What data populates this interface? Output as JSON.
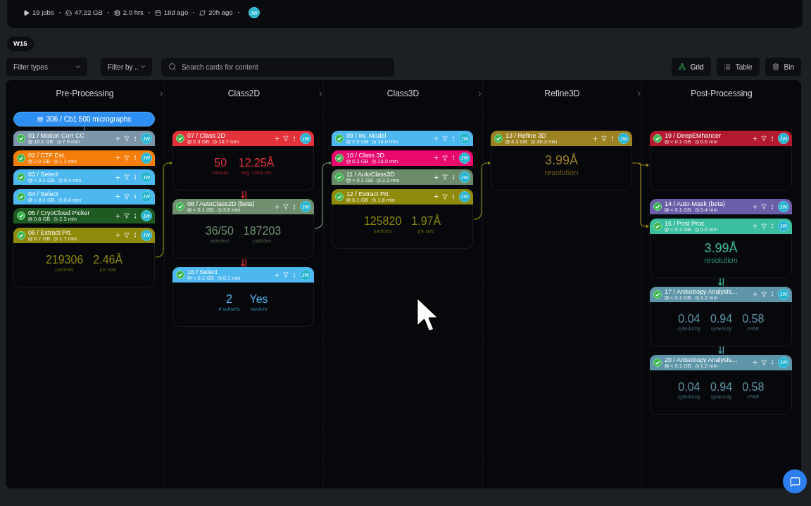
{
  "summary": {
    "stats": [
      {
        "kind": "jobs",
        "text": "19 jobs"
      },
      {
        "kind": "storage",
        "text": "47.22 GB"
      },
      {
        "kind": "compute",
        "text": "2.0 hrs"
      },
      {
        "kind": "created",
        "text": "18d ago"
      },
      {
        "kind": "updated",
        "text": "20h ago"
      }
    ],
    "owner": "JW"
  },
  "workspace_tag": "W15",
  "toolbar": {
    "filters": [
      {
        "label": "Filter types"
      },
      {
        "label": "Filter by .."
      }
    ],
    "search": {
      "placeholder": "Search cards for content"
    },
    "actions": [
      {
        "kind": "grid",
        "label": "Grid",
        "selected": true
      },
      {
        "kind": "table",
        "label": "Table",
        "selected": false
      },
      {
        "kind": "bin",
        "label": "Bin",
        "selected": false
      }
    ]
  },
  "board": {
    "columns": [
      {
        "title": "Pre-Processing",
        "source": "306 / Cb1 500 micrographs",
        "groups": [
          {
            "cards": [
              {
                "title": "01 / Motion Corr CC",
                "size": "16.1 GB",
                "time": "7.9 min",
                "color": "#7d95a8",
                "owner": "JW"
              },
              {
                "title": "02 / CTF Est.",
                "size": "2.0 GB",
                "time": "1.1 min",
                "color": "#f57d0a",
                "owner": "JW"
              },
              {
                "title": "03 / Select",
                "size": "< 0.1 GB",
                "time": "0.4 min",
                "color": "#4db8f0",
                "owner": "JW"
              },
              {
                "title": "04 / Select",
                "size": "< 0.1 GB",
                "time": "0.4 min",
                "color": "#4db8f0",
                "owner": "JW"
              },
              {
                "title": "05 / CryoCloud Picker",
                "size": "0.6 GB",
                "time": "2.3 min",
                "color": "#1f5a22",
                "owner": "JW"
              },
              {
                "title": "06 / Extract Prt.",
                "size": "6.7 GB",
                "time": "1.7 min",
                "color": "#8f8a0a",
                "owner": "JW"
              }
            ],
            "stats": [
              {
                "value": "219306",
                "label": "particles"
              },
              {
                "value": "2.46Å",
                "label": "pix size"
              }
            ]
          }
        ]
      },
      {
        "title": "Class2D",
        "groups": [
          {
            "cards": [
              {
                "title": "07 / Class 2D",
                "size": "2.3 GB",
                "time": "16.7 min",
                "color": "#e3323b",
                "owner": "JW"
              }
            ],
            "stats": [
              {
                "value": "50",
                "label": "classes"
              },
              {
                "value": "12.25Å",
                "label": "avg. class res"
              }
            ]
          },
          {
            "arrow": {
              "color": "#e0303a"
            },
            "cards": [
              {
                "title": "08 / AutoClass2D (beta)",
                "size": "< 0.1 GB",
                "time": "3.6 min",
                "color": "#6f8f6f",
                "owner": "JW"
              }
            ],
            "stats": [
              {
                "value": "36/50",
                "label": "selected"
              },
              {
                "value": "187203",
                "label": "particles"
              }
            ]
          },
          {
            "arrow": {
              "color": "#e0303a"
            },
            "cards": [
              {
                "title": "16 / Select",
                "size": "< 0.1 GB",
                "time": "0.1 min",
                "color": "#4db8f0",
                "owner": "JW"
              }
            ],
            "stats": [
              {
                "value": "2",
                "label": "# subsets"
              },
              {
                "value": "Yes",
                "label": "random"
              }
            ]
          }
        ]
      },
      {
        "title": "Class3D",
        "groups": [
          {
            "cards": [
              {
                "title": "09 / Ini. Model",
                "size": "2.5 GB",
                "time": "14.0 min",
                "color": "#4db8f0",
                "owner": "JW"
              },
              {
                "title": "10 / Class 3D",
                "size": "8.3 GB",
                "time": "28.0 min",
                "color": "#e8086e",
                "owner": "JW"
              },
              {
                "title": "11 / AutoClass3D",
                "size": "< 0.1 GB",
                "time": "2.3 min",
                "color": "#6b8b6b",
                "owner": "JW"
              },
              {
                "title": "12 / Extract Prt.",
                "size": "6.1 GB",
                "time": "1.8 min",
                "color": "#8f8a0a",
                "owner": "JW"
              }
            ],
            "stats": [
              {
                "value": "125820",
                "label": "particles"
              },
              {
                "value": "1.97Å",
                "label": "pix size"
              }
            ]
          }
        ]
      },
      {
        "title": "Refine3D",
        "groups": [
          {
            "cards": [
              {
                "title": "13 / Refine 3D",
                "size": "4.3 GB",
                "time": "30.3 min",
                "color": "#9c8222",
                "owner": "JW"
              }
            ],
            "stats": [
              {
                "value": "3.99Å",
                "label": "resolution"
              }
            ]
          }
        ]
      },
      {
        "title": "Post-Processing",
        "groups": [
          {
            "cards": [
              {
                "title": "19 / DeepEMhancer",
                "size": "< 0.1 GB",
                "time": "6.6 min",
                "color": "#b31a30",
                "owner": "JW"
              }
            ]
          },
          {
            "cards": [
              {
                "title": "14 / Auto-Mask (beta)",
                "size": "< 0.1 GB",
                "time": "0.4 min",
                "color": "#6a5ea8",
                "owner": "JW"
              },
              {
                "title": "15 / Post Proc.",
                "size": "< 0.1 GB",
                "time": "0.6 min",
                "color": "#3cbfa0",
                "owner": "JW"
              }
            ],
            "stats": [
              {
                "value": "3.99Å",
                "label": "resolution"
              }
            ]
          },
          {
            "arrow": {
              "color": "#3cbfa0"
            },
            "cards": [
              {
                "title": "17 / Anisotropy Analysis…",
                "size": "< 0.1 GB",
                "time": "1.2 min",
                "color": "#5f95a8",
                "owner": "JW"
              }
            ],
            "stats": [
              {
                "value": "0.04",
                "label": "cylindricity"
              },
              {
                "value": "0.94",
                "label": "sphericity"
              },
              {
                "value": "0.58",
                "label": "cFAR"
              }
            ]
          },
          {
            "arrow": {
              "color": "#4fa9b8"
            },
            "cards": [
              {
                "title": "20 / Anisotropy Analysis…",
                "size": "< 0.1 GB",
                "time": "1.2 min",
                "color": "#5f95a8",
                "owner": "JW"
              }
            ],
            "stats": [
              {
                "value": "0.04",
                "label": "cylindricity"
              },
              {
                "value": "0.94",
                "label": "sphericity"
              },
              {
                "value": "0.58",
                "label": "cFAR"
              }
            ]
          }
        ]
      }
    ]
  }
}
